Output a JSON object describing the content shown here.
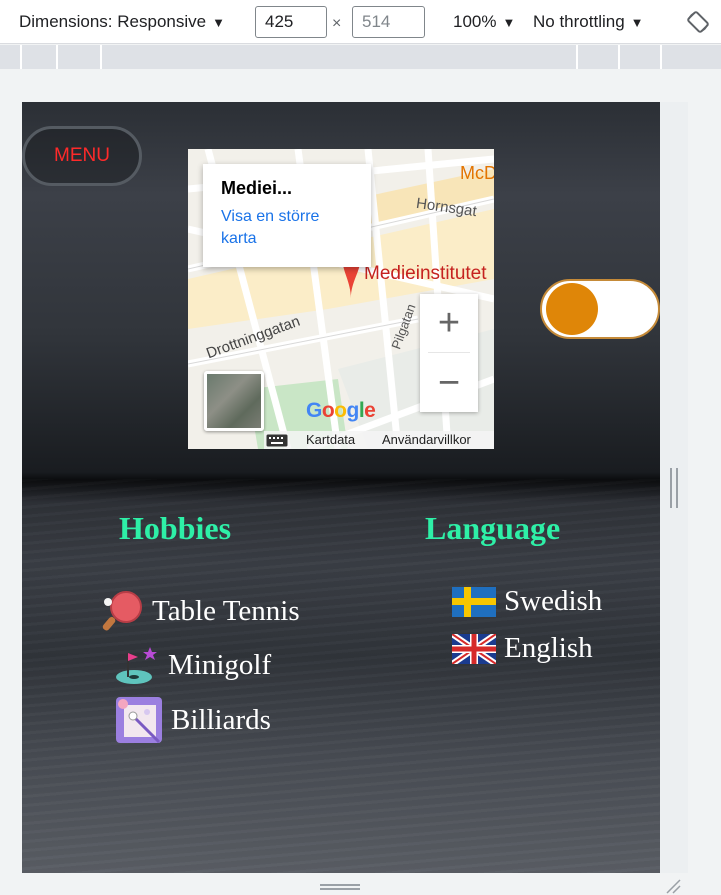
{
  "toolbar": {
    "dimensions_label": "Dimensions: Responsive",
    "width_value": "425",
    "height_placeholder": "514",
    "times": "×",
    "zoom": "100%",
    "throttling": "No throttling",
    "caret": "▼"
  },
  "page": {
    "menu_label": "MENU",
    "map": {
      "popup_title": "Mediei...",
      "popup_link": "Visa en större karta",
      "place_label": "Medieinstitutet",
      "street_labels": [
        "Hornsgat",
        "Drottninggatan",
        "Pilgatan",
        "McD"
      ],
      "zoom_in": "+",
      "zoom_out": "−",
      "google": "Google",
      "footer_data": "Kartdata",
      "footer_terms": "Användarvillkor"
    },
    "hobbies": {
      "title": "Hobbies",
      "items": [
        {
          "label": "Table Tennis",
          "icon": "table-tennis-icon"
        },
        {
          "label": "Minigolf",
          "icon": "minigolf-icon"
        },
        {
          "label": "Billiards",
          "icon": "billiards-icon"
        }
      ]
    },
    "language": {
      "title": "Language",
      "items": [
        {
          "label": "Swedish",
          "icon": "sweden-flag-icon"
        },
        {
          "label": "English",
          "icon": "uk-flag-icon"
        }
      ]
    }
  },
  "colors": {
    "heading": "#2ef0a7",
    "menu_text": "#ff2a2a",
    "toggle_knob": "#df8608"
  }
}
